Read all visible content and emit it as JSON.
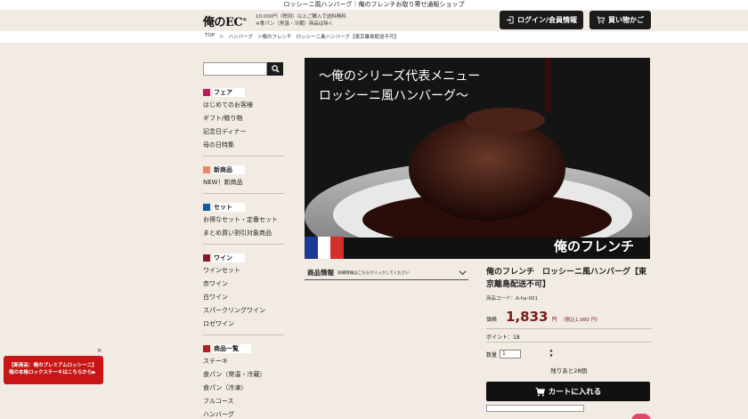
{
  "topbar": {
    "text": "ロッシーニ風ハンバーグ｜俺のフレンチお取り寄せ通販ショップ"
  },
  "header": {
    "logo": "俺のEC",
    "logo_mark": "®",
    "notice_line1": "10,000円（税別）以上ご購入で送料無料",
    "notice_line2": "※食パン（常温・冷蔵）商品は除く",
    "login_label": "ログイン/会員情報",
    "cart_label": "買い物かご"
  },
  "breadcrumb": [
    "TOP",
    "＞",
    "ハンバーグ",
    "＞俺のフレンチ",
    "ロッシーニ風ハンバーグ【東京離島配送不可】"
  ],
  "search": {
    "placeholder": ""
  },
  "sidebar": {
    "categories": [
      {
        "title": "フェア",
        "color": "#c2185b",
        "items": [
          "はじめてのお客様",
          "ギフト/贈り物",
          "記念日ディナー",
          "母の日特集"
        ]
      },
      {
        "title": "新商品",
        "color": "#e8896b",
        "items": [
          "NEW！新商品"
        ]
      },
      {
        "title": "セット",
        "color": "#0d5aa7",
        "items": [
          "お得なセット・定番セット",
          "まとめ買い割引対象商品"
        ]
      },
      {
        "title": "ワイン",
        "color": "#8b1530",
        "items": [
          "ワインセット",
          "赤ワイン",
          "白ワイン",
          "スパークリングワイン",
          "ロゼワイン"
        ]
      },
      {
        "title": "商品一覧",
        "color": "#b71c1c",
        "items": [
          "ステーキ",
          "食パン（常温・冷蔵）",
          "食パン（冷凍）",
          "フルコース",
          "ハンバーグ"
        ]
      }
    ]
  },
  "hero": {
    "line1": "～俺のシリーズ代表メニュー",
    "line2": "ロッシーニ風ハンバーグ～",
    "brand": "俺のフレンチ"
  },
  "info_tab": {
    "title": "商品情報",
    "hint": "詳細情報はこちらクリックしてください"
  },
  "product": {
    "name": "俺のフレンチ　ロッシーニ風ハンバーグ【東京離島配送不可】",
    "code": "商品コード：A-ha-001",
    "price_label": "価格",
    "price": "1,833",
    "price_unit": "円",
    "price_tax": "（税込1,980 円）",
    "points": "ポイント：18",
    "qty_label": "数量",
    "qty_value": "1",
    "stock": "残りあと28個",
    "cart_button": "カートに入れる"
  },
  "promo_banner": {
    "line1": "【新商品：俺のプレミアムロッシーニ】",
    "line2": "俺の本格ロックステーキはこちらから▶",
    "close": "×"
  },
  "colors": {
    "accent": "#1b1b1b",
    "price": "#7a1a1a",
    "banner": "#c81616",
    "background": "#f1ebe3"
  }
}
